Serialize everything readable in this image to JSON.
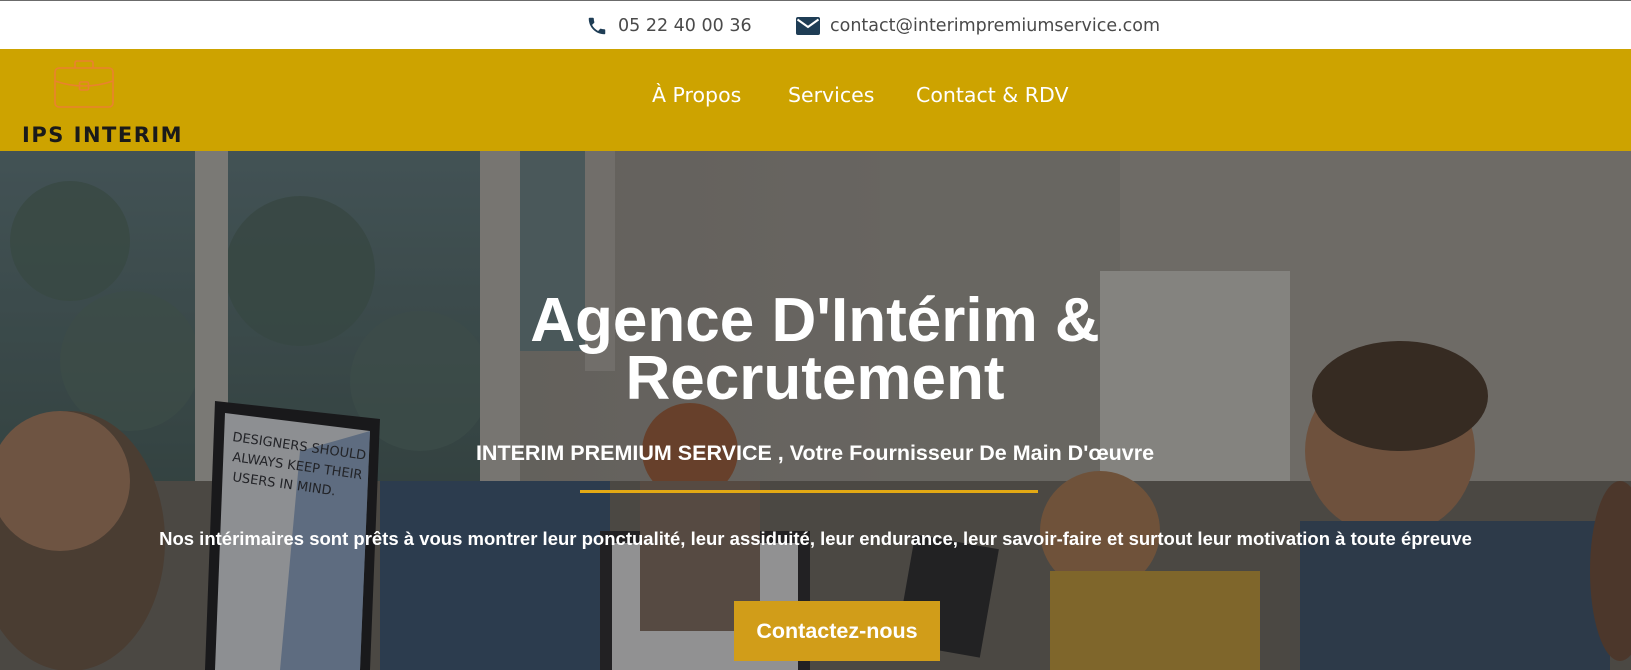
{
  "topbar": {
    "phone": "05 22 40 00 36",
    "email": "contact@interimpremiumservice.com",
    "icons": {
      "phone": "phone-icon",
      "email": "envelope-icon"
    },
    "icon_color": "#1f3d55"
  },
  "header": {
    "logo_text": "IPS INTERIM",
    "logo_icon": "briefcase-icon",
    "nav": {
      "about": "À Propos",
      "services": "Services",
      "contact": "Contact & RDV"
    },
    "background_color": "#cda300"
  },
  "hero": {
    "title_line1": "Agence D'Intérim &",
    "title_line2": "Recrutement",
    "subtitle": "INTERIM PREMIUM SERVICE , Votre Fournisseur De Main D'œuvre",
    "text": "Nos intérimaires sont prêts à vous montrer leur ponctualité, leur assiduité, leur endurance, leur savoir-faire et surtout leur motivation à toute épreuve",
    "cta_label": "Contactez-nous",
    "accent_color": "#e3a914",
    "monitor_text": "DESIGNERS SHOULD ALWAYS KEEP THEIR USERS IN MIND."
  }
}
